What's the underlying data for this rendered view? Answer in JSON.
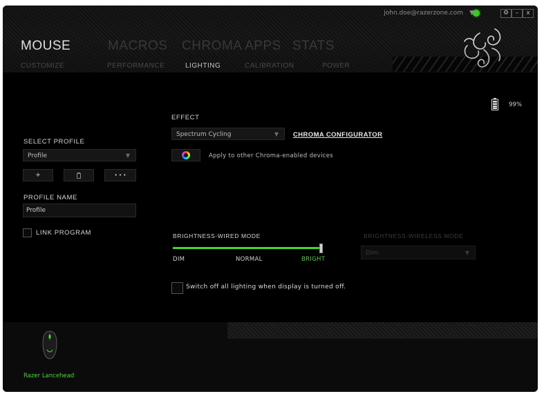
{
  "header": {
    "user_email": "john.doe@razerzone.com",
    "user_caret": "▼",
    "window_controls": {
      "settings": "⚙",
      "minimize": "–",
      "close": "x"
    },
    "main_tabs": [
      {
        "label": "MOUSE",
        "active": true
      },
      {
        "label": "MACROS",
        "active": false
      },
      {
        "label": "CHROMA APPS",
        "active": false
      },
      {
        "label": "STATS",
        "active": false
      }
    ],
    "sub_tabs": [
      {
        "label": "CUSTOMIZE",
        "active": false
      },
      {
        "label": "PERFORMANCE",
        "active": false
      },
      {
        "label": "LIGHTING",
        "active": true
      },
      {
        "label": "CALIBRATION",
        "active": false
      },
      {
        "label": "POWER",
        "active": false
      }
    ]
  },
  "profile": {
    "select_label": "SELECT PROFILE",
    "selected": "Profile",
    "add_label": "+",
    "delete_label": "🗑",
    "more_label": "• • •",
    "name_label": "PROFILE NAME",
    "name_value": "Profile",
    "link_program_label": "LINK PROGRAM"
  },
  "lighting": {
    "effect_label": "EFFECT",
    "effect_value": "Spectrum Cycling",
    "chroma_configurator": "CHROMA CONFIGURATOR",
    "apply_label": "Apply to other Chroma-enabled devices",
    "brightness_wired_label": "BRIGHTNESS-WIRED MODE",
    "brightness_wired_ticks": [
      "DIM",
      "NORMAL",
      "BRIGHT"
    ],
    "brightness_wired_level": 1.0,
    "brightness_wireless_label": "BRIGHTNESS-WIRELESS MODE",
    "brightness_wireless_value": "Dim",
    "switch_off_label": "Switch off all lighting when display is turned off."
  },
  "battery": {
    "percent": "99%"
  },
  "footer": {
    "device_name": "Razer Lancehead"
  },
  "colors": {
    "accent": "#44d62c",
    "background": "#000000",
    "inactive_tab": "#3a3a3a"
  }
}
